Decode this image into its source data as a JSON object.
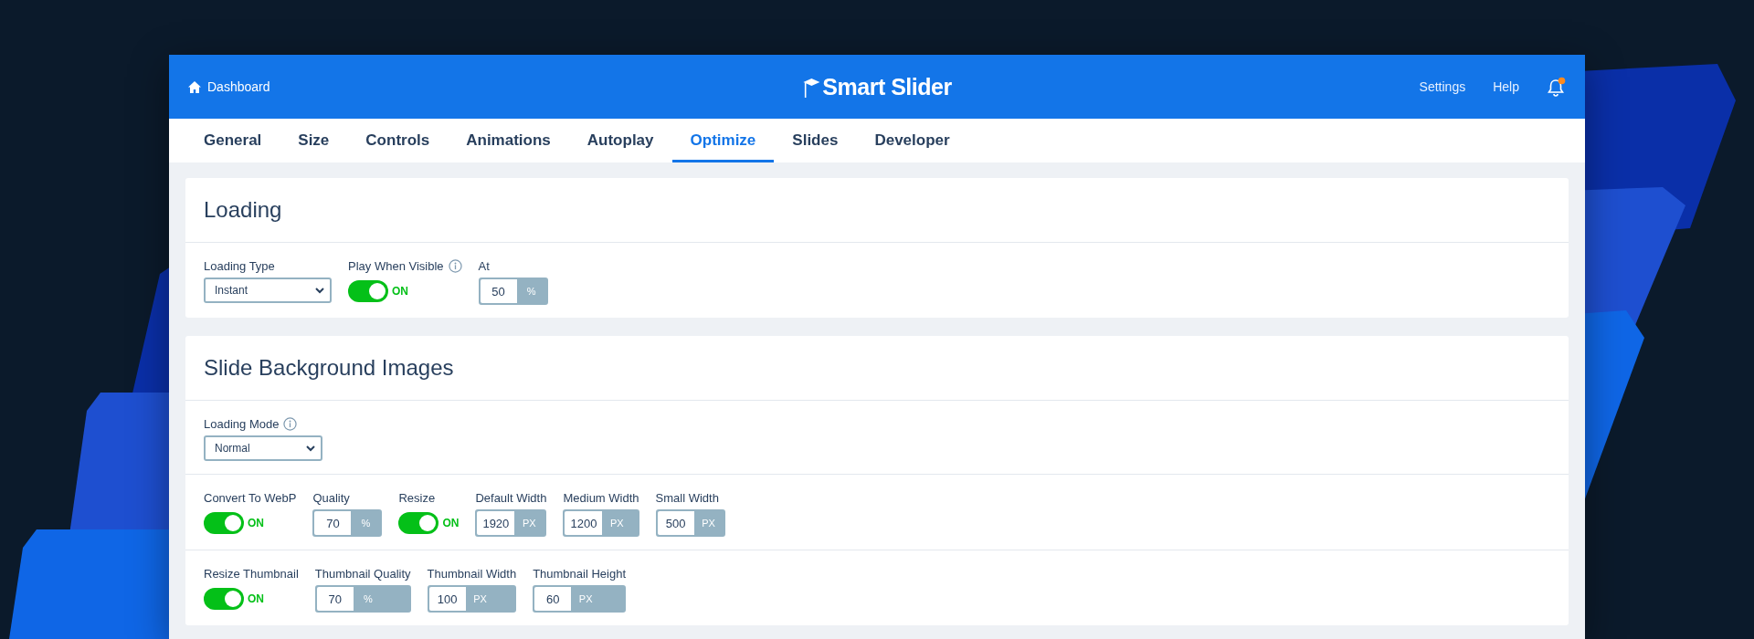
{
  "header": {
    "dashboard": "Dashboard",
    "logo": "Smart Slider",
    "links": [
      "Settings",
      "Help"
    ]
  },
  "tabs": [
    {
      "label": "General",
      "selected": false
    },
    {
      "label": "Size",
      "selected": false
    },
    {
      "label": "Controls",
      "selected": false
    },
    {
      "label": "Animations",
      "selected": false
    },
    {
      "label": "Autoplay",
      "selected": false
    },
    {
      "label": "Optimize",
      "selected": true
    },
    {
      "label": "Slides",
      "selected": false
    },
    {
      "label": "Developer",
      "selected": false
    }
  ],
  "panels": [
    {
      "title": "Loading",
      "rows": [
        {
          "fields": [
            {
              "kind": "select",
              "label": "Loading Type",
              "value": "Instant",
              "wide": false
            },
            {
              "kind": "toggle",
              "label": "Play When Visible",
              "info": true,
              "on": true,
              "state_label": "ON"
            },
            {
              "kind": "number",
              "label": "At",
              "value": "50",
              "unit": "%"
            }
          ]
        }
      ]
    },
    {
      "title": "Slide Background Images",
      "rows": [
        {
          "fields": [
            {
              "kind": "select",
              "label": "Loading Mode",
              "value": "Normal",
              "info": true,
              "wide": true
            }
          ]
        },
        {
          "fields": [
            {
              "kind": "toggle",
              "label": "Convert To WebP",
              "on": true,
              "state_label": "ON"
            },
            {
              "kind": "number",
              "label": "Quality",
              "value": "70",
              "unit": "%"
            },
            {
              "kind": "toggle",
              "label": "Resize",
              "on": true,
              "state_label": "ON"
            },
            {
              "kind": "number",
              "label": "Default Width",
              "value": "1920",
              "unit": "PX"
            },
            {
              "kind": "number",
              "label": "Medium Width",
              "value": "1200",
              "unit": "PX"
            },
            {
              "kind": "number",
              "label": "Small Width",
              "value": "500",
              "unit": "PX"
            }
          ]
        },
        {
          "fields": [
            {
              "kind": "toggle",
              "label": "Resize Thumbnail",
              "on": true,
              "state_label": "ON"
            },
            {
              "kind": "number",
              "label": "Thumbnail Quality",
              "value": "70",
              "unit": "%"
            },
            {
              "kind": "number",
              "label": "Thumbnail Width",
              "value": "100",
              "unit": "PX"
            },
            {
              "kind": "number",
              "label": "Thumbnail Height",
              "value": "60",
              "unit": "PX"
            }
          ]
        }
      ]
    }
  ]
}
